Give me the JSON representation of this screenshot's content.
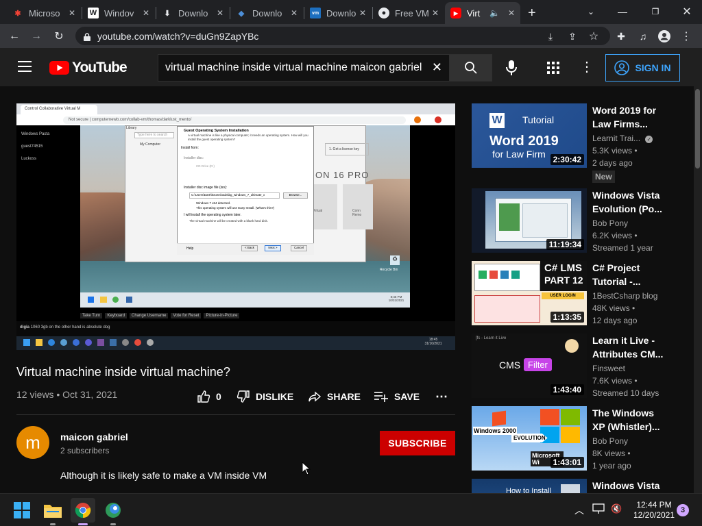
{
  "browser": {
    "tabs": [
      {
        "label": "Microso",
        "favicon": "joomla-icon"
      },
      {
        "label": "Windov",
        "favicon": "wikipedia-icon"
      },
      {
        "label": "Downlo",
        "favicon": "download-icon"
      },
      {
        "label": "Downlo",
        "favicon": "virtualbox-icon"
      },
      {
        "label": "Downlo",
        "favicon": "vmware-icon"
      },
      {
        "label": "Free VM",
        "favicon": "github-icon"
      },
      {
        "label": "Virt",
        "favicon": "youtube-icon"
      }
    ],
    "url": "youtube.com/watch?v=duGn9ZapYBc",
    "new_tab": "+"
  },
  "youtube": {
    "logo_text": "YouTube",
    "search_query": "virtual machine inside virtual machine maicon gabriel",
    "signin_label": "SIGN IN"
  },
  "video": {
    "title": "Virtual machine inside virtual machine?",
    "meta": "12 views • Oct 31, 2021",
    "likes": "0",
    "dislike_label": "DISLIKE",
    "share_label": "SHARE",
    "save_label": "SAVE",
    "channel": "maicon gabriel",
    "avatar_letter": "m",
    "subscribers": "2 subscribers",
    "subscribe_label": "SUBSCRIBE",
    "description": "Although it is likely safe to make a VM inside VM",
    "player": {
      "browser_tab": "Control Collaborative Virtual M",
      "browser_url": "Not secure | computernewb.com/collab-vm/thomas/darklust_mento/",
      "users": [
        "Windows Pasta",
        "guest74515",
        "Luckoss"
      ],
      "dialog_title": "Guest Operating System Installation",
      "dialog_intro": "A virtual machine is like a physical computer; it needs an operating system. How will you install the guest operating system?",
      "install_from": "Install from:",
      "opt_disc": "Installer disc:",
      "disc_drive": "CD Drive (D:)",
      "opt_iso": "Installer disc image file (iso):",
      "iso_path": "C:\\Users\\Darth\\Downloads\\bg_windows_7_ultimate_x",
      "browse_label": "Browse...",
      "detected": "Windows 7 x64 detected.",
      "easy_install": "This operating system will use Easy Install. (What's this?)",
      "opt_later": "I will install the operating system later.",
      "later_note": "The virtual machine will be created with a blank hard disk.",
      "help_label": "Help",
      "back_label": "< Back",
      "next_label": "Next >",
      "cancel_label": "Cancel",
      "library_label": "Library",
      "library_search": "Type here to search",
      "my_computer": "My Computer",
      "vmware_banner": "ON 16 PRO",
      "license_label": "1. Get a license key",
      "tile_label": "Virtual",
      "tile_label2": "Conn Remo",
      "recycle_bin": "Recycle Bin",
      "guest_clock": "8:45 PM\n10/31/2021",
      "buttons": [
        "Take Turn",
        "Keyboard",
        "Change Username",
        "Vote for Reset",
        "Picture-in-Picture"
      ],
      "chat_user": "digia",
      "chat_msg": "1060 3gb on the other hand is absolute dog",
      "host_clock": "18:45\n31/10/2021"
    }
  },
  "recommendations": [
    {
      "title_l1": "Word 2019 for",
      "title_l2": "Law Firms...",
      "channel": "Learnit Trai...",
      "verified": true,
      "views": "5.3K views •",
      "date": "2 days ago",
      "badge": "New",
      "duration": "2:30:42",
      "thumb_text": "Word 2019",
      "thumb_sub": "for Law Firm",
      "thumb_tag": "Tutorial",
      "thumb_logo": "W"
    },
    {
      "title_l1": "Windows Vista",
      "title_l2": "Evolution (Po...",
      "channel": "Bob Pony",
      "views": "6.2K views •",
      "date": "Streamed 1 year",
      "duration": "11:19:34"
    },
    {
      "title_l1": "C# Project",
      "title_l2": "Tutorial -...",
      "channel": "1BestCsharp blog",
      "views": "48K views •",
      "date": "12 days ago",
      "duration": "1:13:35",
      "thumb_text": "C# LMS",
      "thumb_sub": "PART 12",
      "thumb_tag": "USER LOGIN"
    },
    {
      "title_l1": "Learn it Live -",
      "title_l2": "Attributes CM...",
      "channel": "Finsweet",
      "views": "7.6K views •",
      "date": "Streamed 10 days",
      "duration": "1:43:40",
      "thumb_text": "CMS",
      "thumb_sub": "Filter",
      "thumb_tag": "[fs - Learn it Live"
    },
    {
      "title_l1": "The Windows",
      "title_l2": "XP (Whistler)...",
      "channel": "Bob Pony",
      "views": "8K views •",
      "date": "1 year ago",
      "duration": "1:43:01",
      "thumb_text": "Windows 2000",
      "thumb_sub": "EVOLUTION",
      "thumb_tag": "Microsoft Wi"
    },
    {
      "title_l1": "Windows Vista",
      "thumb_text": "How to Install"
    }
  ],
  "taskbar": {
    "time": "12:44 PM",
    "date": "12/20/2021",
    "notifications": "3"
  },
  "colors": {
    "accent": "#3ea6ff",
    "subscribe": "#cc0000",
    "youtube_red": "#ff0000"
  }
}
